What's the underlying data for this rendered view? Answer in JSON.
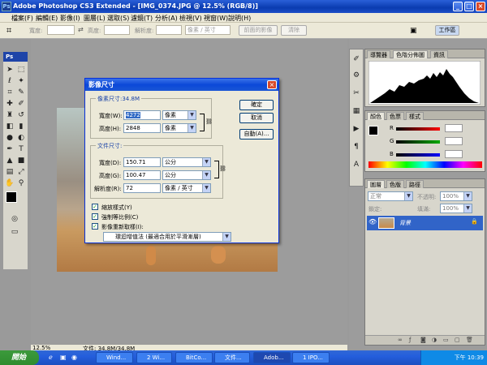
{
  "window": {
    "title": "Adobe Photoshop CS3 Extended - [IMG_0374.JPG @ 12.5% (RGB/8)]",
    "app_badge": "Ps",
    "controls": [
      "_",
      "□",
      "×"
    ]
  },
  "menu": [
    "檔案(F)",
    "編輯(E)",
    "影像(I)",
    "圖層(L)",
    "選取(S)",
    "濾鏡(T)",
    "分析(A)",
    "檢視(V)",
    "視窗(W)",
    "說明(H)"
  ],
  "options_bar": {
    "width_label": "寬度:",
    "height_label": "高度:",
    "resolution_label": "解析度:",
    "unit_option": "像素 / 英寸",
    "front_image_button": "前面的影像",
    "clear_button": "清除",
    "workspace_button": "工作區"
  },
  "toolbox": {
    "header": "Ps"
  },
  "status_bar": {
    "zoom": "12.5%",
    "doc": "文件: 34.8M/34.8M"
  },
  "panels": {
    "histogram_tabs": [
      "導覽器",
      "色階分佈圖",
      "資訊"
    ],
    "color_tabs": [
      "顏色",
      "色票",
      "樣式"
    ],
    "color_channels": [
      "R",
      "G",
      "B"
    ],
    "layers_tabs": [
      "圖層",
      "色版",
      "路徑"
    ],
    "blend_mode": "正常",
    "opacity_label": "不透明:",
    "opacity_value": "100%",
    "lock_label": "鎖定:",
    "fill_label": "填滿:",
    "fill_value": "100%",
    "layer_name": "背景"
  },
  "dialog": {
    "title": "影像尺寸",
    "pixel_dimensions_label": "像素尺寸:34.8M",
    "px_width_label": "寬度(W):",
    "px_width_value": "4272",
    "px_width_unit": "像素",
    "px_height_label": "高度(H):",
    "px_height_value": "2848",
    "px_height_unit": "像素",
    "doc_size_label": "文件尺寸:",
    "doc_width_label": "寬度(D):",
    "doc_width_value": "150.71",
    "doc_width_unit": "公分",
    "doc_height_label": "高度(G):",
    "doc_height_value": "100.47",
    "doc_height_unit": "公分",
    "resolution_label": "解析度(R):",
    "resolution_value": "72",
    "resolution_unit": "像素 / 英寸",
    "ok_button": "確定",
    "cancel_button": "取消",
    "auto_button": "自動(A)...",
    "scale_styles": "縮放樣式(Y)",
    "constrain": "強制等比例(C)",
    "resample": "影像重新取樣(I):",
    "resample_method": "環迴增值法 (最適合用於平滑漸層)"
  },
  "taskbar": {
    "start": "開始",
    "tasks": [
      "Wind...",
      "2 Wi...",
      "BitCo...",
      "文件...",
      "Adob...",
      "1 IPO..."
    ],
    "clock": "下午 10:39"
  }
}
